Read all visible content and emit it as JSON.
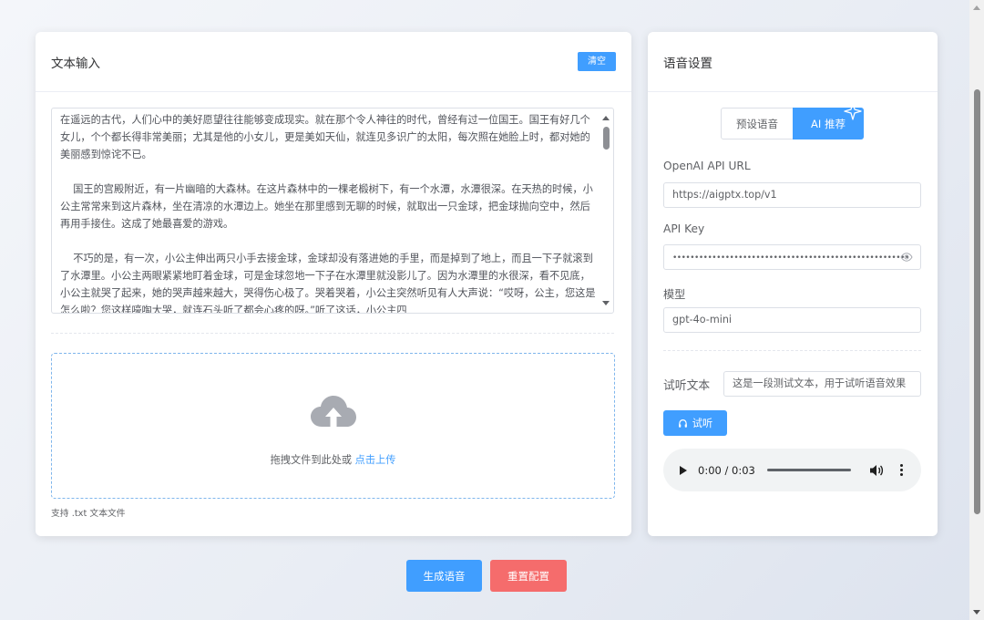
{
  "text_card": {
    "title": "文本输入",
    "clear_label": "清空",
    "text_content": "在遥远的古代，人们心中的美好愿望往往能够变成现实。就在那个令人神往的时代，曾经有过一位国王。国王有好几个女儿，个个都长得非常美丽；尤其是他的小女儿，更是美如天仙，就连见多识广的太阳，每次照在她脸上时，都对她的美丽感到惊诧不已。\n\n    国王的宫殿附近，有一片幽暗的大森林。在这片森林中的一棵老椴树下，有一个水潭，水潭很深。在天热的时候，小公主常常来到这片森林，坐在清凉的水潭边上。她坐在那里感到无聊的时候，就取出一只金球，把金球抛向空中，然后再用手接住。这成了她最喜爱的游戏。\n\n    不巧的是，有一次，小公主伸出两只小手去接金球，金球却没有落进她的手里，而是掉到了地上，而且一下子就滚到了水潭里。小公主两眼紧紧地盯着金球，可是金球忽地一下子在水潭里就没影儿了。因为水潭里的水很深，看不见底，小公主就哭了起来，她的哭声越来越大，哭得伤心极了。哭着哭着，小公主突然听见有人大声说：“哎呀，公主，您这是怎么啦？您这样嚎啕大哭，就连石头听了都会心疼的呀。”听了这话，小公主四",
    "upload_hint": "拖拽文件到此处或 ",
    "upload_link": "点击上传",
    "upload_tip": "支持 .txt 文本文件"
  },
  "voice_card": {
    "title": "语音设置",
    "tabs": [
      {
        "label": "预设语音",
        "active": false
      },
      {
        "label": "AI 推荐",
        "active": true
      }
    ],
    "api_url_label": "OpenAI API URL",
    "api_url_value": "https://aigptx.top/v1",
    "api_key_label": "API Key",
    "api_key_masked": "••••••••••••••••••••••••••••••••••••••••••••••••••••••",
    "model_label": "模型",
    "model_value": "gpt-4o-mini",
    "test_text_label": "试听文本",
    "test_text_value": "这是一段测试文本，用于试听语音效果",
    "listen_label": "试听",
    "audio_time": "0:00 / 0:03"
  },
  "actions": {
    "generate_label": "生成语音",
    "reset_label": "重置配置"
  },
  "colors": {
    "primary": "#409eff",
    "danger": "#f56c6c"
  }
}
